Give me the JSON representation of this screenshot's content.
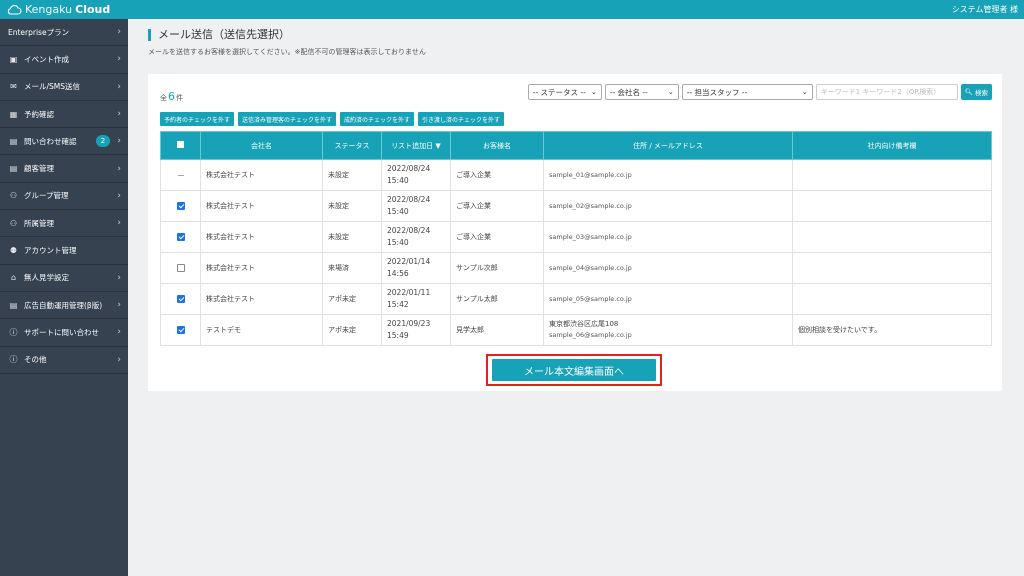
{
  "header": {
    "logo_light": "Kengaku",
    "logo_bold": "Cloud",
    "user": "システム管理者 様"
  },
  "sidebar": {
    "items": [
      {
        "label": "Enterpriseプラン",
        "icon": "none",
        "chevron": true
      },
      {
        "label": "イベント作成",
        "icon": "image-icon",
        "chevron": true
      },
      {
        "label": "メール/SMS送信",
        "icon": "envelope-icon",
        "chevron": true
      },
      {
        "label": "予約確認",
        "icon": "calendar-icon",
        "chevron": true
      },
      {
        "label": "問い合わせ確認",
        "icon": "id-card-icon",
        "chevron": true,
        "badge": "2"
      },
      {
        "label": "顧客管理",
        "icon": "id-card-icon",
        "chevron": true
      },
      {
        "label": "グループ管理",
        "icon": "users-icon",
        "chevron": true
      },
      {
        "label": "所属管理",
        "icon": "users-icon",
        "chevron": true
      },
      {
        "label": "アカウント管理",
        "icon": "user-tie-icon",
        "chevron": false
      },
      {
        "label": "無人見学設定",
        "icon": "home-icon",
        "chevron": true
      },
      {
        "label": "広告自動運用管理(β版)",
        "icon": "id-card-icon",
        "chevron": true
      },
      {
        "label": "サポートに問い合わせ",
        "icon": "info-icon",
        "chevron": true
      },
      {
        "label": "その他",
        "icon": "info-icon",
        "chevron": true
      }
    ]
  },
  "page": {
    "title": "メール送信（送信先選択）",
    "subtitle": "メールを送信するお客様を選択してください。※配信不可の管理客は表示しておりません"
  },
  "count": {
    "prefix": "全",
    "value": "6",
    "suffix": "件"
  },
  "filters": {
    "status": "-- ステータス --",
    "company": "-- 会社名 --",
    "staff": "-- 担当スタッフ --",
    "keyword_placeholder": "キーワード1 キーワード2（OR検索）",
    "search_label": "検索"
  },
  "check_buttons": [
    "予約者のチェックを外す",
    "送信済み管理客のチェックを外す",
    "成約済のチェックを外す",
    "引き渡し済のチェックを外す"
  ],
  "table": {
    "headers": [
      "会社名",
      "ステータス",
      "リスト追加日 ▼",
      "お客様名",
      "住所 / メールアドレス",
      "社内向け備考欄"
    ],
    "rows": [
      {
        "check": "disabled",
        "company": "株式会社テスト",
        "status": "未設定",
        "date": "2022/08/24",
        "time": "15:40",
        "name": "ご導入企業",
        "address": "",
        "email": "sample_01@sample.co.jp",
        "note": ""
      },
      {
        "check": "checked",
        "company": "株式会社テスト",
        "status": "未設定",
        "date": "2022/08/24",
        "time": "15:40",
        "name": "ご導入企業",
        "address": "",
        "email": "sample_02@sample.co.jp",
        "note": ""
      },
      {
        "check": "checked",
        "company": "株式会社テスト",
        "status": "未設定",
        "date": "2022/08/24",
        "time": "15:40",
        "name": "ご導入企業",
        "address": "",
        "email": "sample_03@sample.co.jp",
        "note": ""
      },
      {
        "check": "unchecked",
        "company": "株式会社テスト",
        "status": "来場済",
        "date": "2022/01/14",
        "time": "14:56",
        "name": "サンプル次郎",
        "address": "",
        "email": "sample_04@sample.co.jp",
        "note": ""
      },
      {
        "check": "checked",
        "company": "株式会社テスト",
        "status": "アポ未定",
        "date": "2022/01/11",
        "time": "15:42",
        "name": "サンプル太郎",
        "address": "",
        "email": "sample_05@sample.co.jp",
        "note": ""
      },
      {
        "check": "checked",
        "company": "テストデモ",
        "status": "アポ未定",
        "date": "2021/09/23",
        "time": "15:49",
        "name": "見学太郎",
        "address": "東京都渋谷区広尾108",
        "email": "sample_06@sample.co.jp",
        "note": "個別相談を受けたいです。"
      }
    ]
  },
  "action_button": "メール本文編集画面へ",
  "colors": {
    "accent": "#17a2b8",
    "sidebar": "#374250",
    "highlight": "#e2231a"
  }
}
